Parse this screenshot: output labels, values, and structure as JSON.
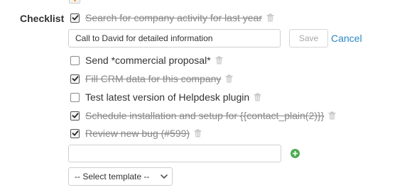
{
  "checklist": {
    "label": "Checklist",
    "items": [
      {
        "text": "Search for company activity for last year",
        "checked": true
      },
      {
        "text": "Send *commercial proposal*",
        "checked": false
      },
      {
        "text": "Fill CRM data for this company",
        "checked": true
      },
      {
        "text": "Test latest version of Helpdesk plugin",
        "checked": false
      },
      {
        "text": "Schedule installation and setup for {{contact_plain(2)}}",
        "checked": true
      },
      {
        "text": "Review new bug (#599)",
        "checked": true
      }
    ],
    "edit": {
      "value": "Call to David for detailed information",
      "save_label": "Save",
      "cancel_label": "Cancel"
    },
    "new_item": {
      "value": ""
    },
    "template_select": {
      "selected": "-- Select template --"
    }
  },
  "colors": {
    "link": "#2a88c8",
    "add_icon": "#4caf50",
    "done_text": "#888888"
  },
  "icons": {
    "delete": "trash-icon",
    "add": "plus-circle-icon",
    "select": "chevron-down-icon",
    "check": "checkmark-icon"
  }
}
